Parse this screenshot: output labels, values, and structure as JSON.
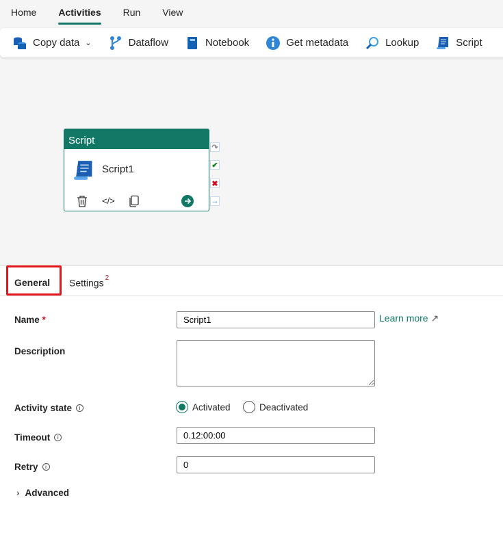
{
  "menu_tabs": [
    "Home",
    "Activities",
    "Run",
    "View"
  ],
  "toolbar": {
    "copy_data": "Copy data",
    "dataflow": "Dataflow",
    "notebook": "Notebook",
    "get_metadata": "Get metadata",
    "lookup": "Lookup",
    "script": "Script"
  },
  "node": {
    "type": "Script",
    "name": "Script1"
  },
  "panel": {
    "tabs": {
      "general": "General",
      "settings": "Settings",
      "settings_badge": "2"
    }
  },
  "form": {
    "name_label": "Name",
    "required_mark": "*",
    "name_value": "Script1",
    "learn_more": "Learn more",
    "description_label": "Description",
    "description_value": "",
    "activity_state_label": "Activity state",
    "activated": "Activated",
    "deactivated": "Deactivated",
    "timeout_label": "Timeout",
    "timeout_value": "0.12:00:00",
    "retry_label": "Retry",
    "retry_value": "0",
    "advanced": "Advanced"
  },
  "colors": {
    "accent": "#117865",
    "highlight": "#e0161c"
  }
}
